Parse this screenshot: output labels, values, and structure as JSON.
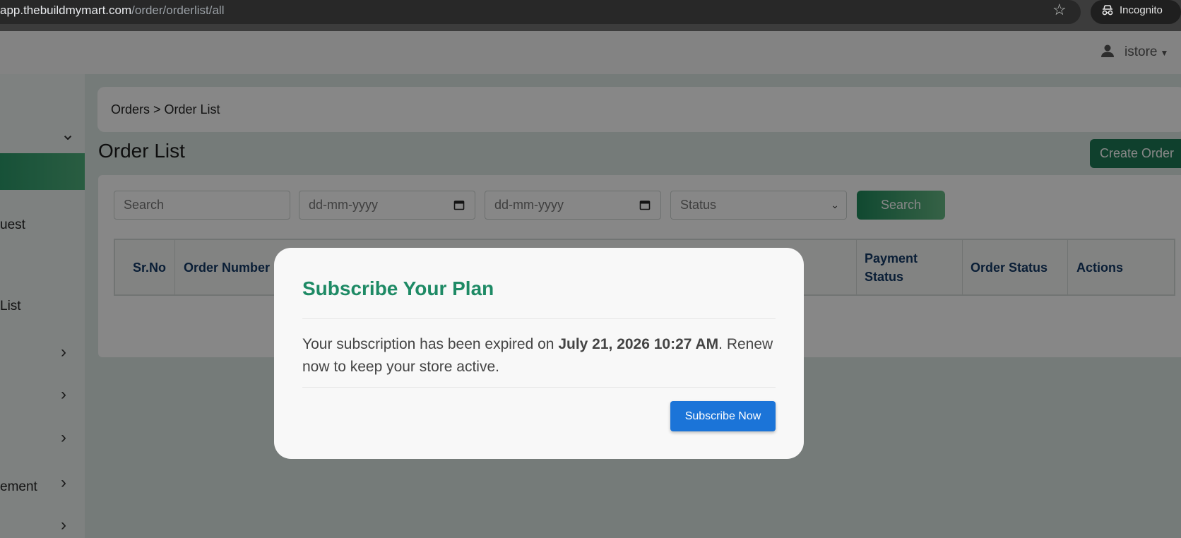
{
  "browser": {
    "url_host": "app.thebuildmymart.com",
    "url_path": "/order/orderlist/all",
    "incognito_label": "Incognito"
  },
  "header": {
    "user_name": "istore"
  },
  "sidebar": {
    "items": [
      {
        "label": "uest"
      },
      {
        "label": "List"
      },
      {
        "label": "ement"
      }
    ]
  },
  "breadcrumb": {
    "text": "Orders > Order List"
  },
  "page": {
    "title": "Order List",
    "create_button": "Create Order"
  },
  "filters": {
    "search_placeholder": "Search",
    "date_from_placeholder": "dd-mm-yyyy",
    "date_to_placeholder": "dd-mm-yyyy",
    "status_label": "Status",
    "search_button": "Search"
  },
  "table": {
    "headers": [
      "Sr.No",
      "Order Number",
      "Payment Status",
      "Order Status",
      "Actions"
    ]
  },
  "modal": {
    "title": "Subscribe Your Plan",
    "body_prefix": "Your subscription has been expired on ",
    "expiry": "July 21, 2026 10:27 AM",
    "body_suffix": ". Renew now to keep your store active.",
    "button": "Subscribe Now"
  }
}
